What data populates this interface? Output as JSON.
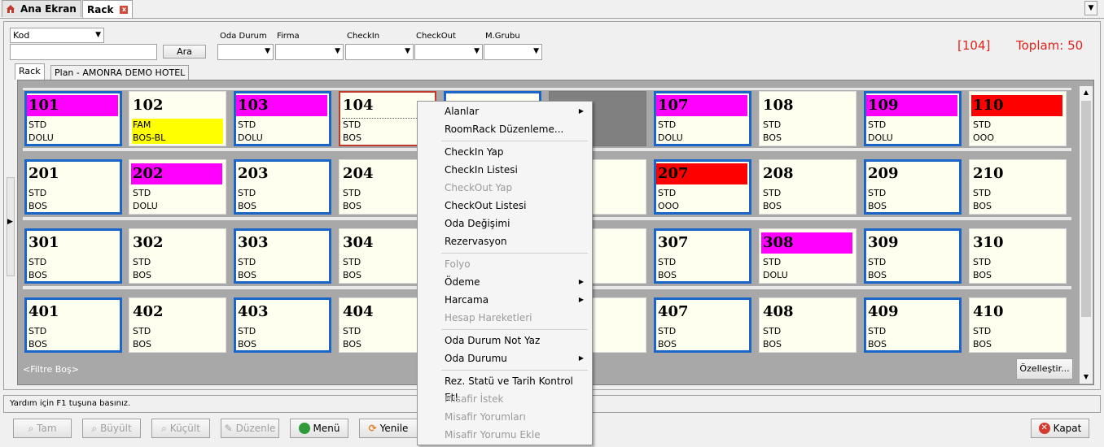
{
  "tabs": {
    "home_label": "Ana Ekran",
    "rack_label": "Rack",
    "close_glyph": "x"
  },
  "filters": {
    "field_select": "Kod",
    "search_value": "",
    "search_button": "Ara",
    "oda_durum_label": "Oda Durum",
    "firma_label": "Firma",
    "checkin_label": "CheckIn",
    "checkout_label": "CheckOut",
    "mgrubu_label": "M.Grubu"
  },
  "info": {
    "selected_room": "[104]",
    "total": "Toplam: 50"
  },
  "inner_tabs": {
    "rack": "Rack",
    "plan": "Plan - AMONRA DEMO HOTEL"
  },
  "rooms": [
    [
      {
        "num": "101",
        "type": "STD",
        "status": "DOLU",
        "num_bg": "#ff00ff",
        "type_bg": "",
        "stat_bg": "",
        "style": "sel"
      },
      {
        "num": "102",
        "type": "FAM",
        "status": "BOS-BL",
        "num_bg": "",
        "type_bg": "#ffff00",
        "stat_bg": "#ffff00",
        "style": "plain"
      },
      {
        "num": "103",
        "type": "STD",
        "status": "DOLU",
        "num_bg": "#ff00ff",
        "type_bg": "",
        "stat_bg": "",
        "style": "sel"
      },
      {
        "num": "104",
        "type": "STD",
        "status": "BOS",
        "num_bg": "",
        "type_bg": "",
        "stat_bg": "",
        "style": "focus"
      },
      {
        "num": "",
        "type": "",
        "status": "",
        "num_bg": "",
        "type_bg": "",
        "stat_bg": "",
        "style": "sel"
      },
      {
        "num": "",
        "type": "",
        "status": "",
        "num_bg": "",
        "type_bg": "",
        "stat_bg": "",
        "style": "gray"
      },
      {
        "num": "107",
        "type": "STD",
        "status": "DOLU",
        "num_bg": "#ff00ff",
        "type_bg": "",
        "stat_bg": "",
        "style": "sel"
      },
      {
        "num": "108",
        "type": "STD",
        "status": "BOS",
        "num_bg": "",
        "type_bg": "",
        "stat_bg": "",
        "style": "plain"
      },
      {
        "num": "109",
        "type": "STD",
        "status": "DOLU",
        "num_bg": "#ff00ff",
        "type_bg": "",
        "stat_bg": "",
        "style": "sel"
      },
      {
        "num": "110",
        "type": "STD",
        "status": "OOO",
        "num_bg": "#ff0000",
        "type_bg": "",
        "stat_bg": "",
        "style": "plain"
      }
    ],
    [
      {
        "num": "201",
        "type": "STD",
        "status": "BOS",
        "num_bg": "",
        "type_bg": "",
        "stat_bg": "",
        "style": "sel"
      },
      {
        "num": "202",
        "type": "STD",
        "status": "DOLU",
        "num_bg": "#ff00ff",
        "type_bg": "",
        "stat_bg": "",
        "style": "plain"
      },
      {
        "num": "203",
        "type": "STD",
        "status": "BOS",
        "num_bg": "",
        "type_bg": "",
        "stat_bg": "",
        "style": "sel"
      },
      {
        "num": "204",
        "type": "STD",
        "status": "BOS",
        "num_bg": "",
        "type_bg": "",
        "stat_bg": "",
        "style": "plain"
      },
      {
        "num": "",
        "type": "",
        "status": "",
        "num_bg": "",
        "type_bg": "",
        "stat_bg": "",
        "style": "sel"
      },
      {
        "num": "",
        "type": "",
        "status": "",
        "num_bg": "",
        "type_bg": "",
        "stat_bg": "",
        "style": "plain"
      },
      {
        "num": "207",
        "type": "STD",
        "status": "OOO",
        "num_bg": "#ff0000",
        "type_bg": "",
        "stat_bg": "",
        "style": "sel"
      },
      {
        "num": "208",
        "type": "STD",
        "status": "BOS",
        "num_bg": "",
        "type_bg": "",
        "stat_bg": "",
        "style": "plain"
      },
      {
        "num": "209",
        "type": "STD",
        "status": "BOS",
        "num_bg": "",
        "type_bg": "",
        "stat_bg": "",
        "style": "sel"
      },
      {
        "num": "210",
        "type": "STD",
        "status": "BOS",
        "num_bg": "",
        "type_bg": "",
        "stat_bg": "",
        "style": "plain"
      }
    ],
    [
      {
        "num": "301",
        "type": "STD",
        "status": "BOS",
        "num_bg": "",
        "type_bg": "",
        "stat_bg": "",
        "style": "sel"
      },
      {
        "num": "302",
        "type": "STD",
        "status": "BOS",
        "num_bg": "",
        "type_bg": "",
        "stat_bg": "",
        "style": "plain"
      },
      {
        "num": "303",
        "type": "STD",
        "status": "BOS",
        "num_bg": "",
        "type_bg": "",
        "stat_bg": "",
        "style": "sel"
      },
      {
        "num": "304",
        "type": "STD",
        "status": "BOS",
        "num_bg": "",
        "type_bg": "",
        "stat_bg": "",
        "style": "plain"
      },
      {
        "num": "",
        "type": "",
        "status": "",
        "num_bg": "",
        "type_bg": "",
        "stat_bg": "",
        "style": "sel"
      },
      {
        "num": "",
        "type": "",
        "status": "",
        "num_bg": "",
        "type_bg": "",
        "stat_bg": "",
        "style": "plain"
      },
      {
        "num": "307",
        "type": "STD",
        "status": "BOS",
        "num_bg": "",
        "type_bg": "",
        "stat_bg": "",
        "style": "sel"
      },
      {
        "num": "308",
        "type": "STD",
        "status": "DOLU",
        "num_bg": "#ff00ff",
        "type_bg": "",
        "stat_bg": "",
        "style": "plain"
      },
      {
        "num": "309",
        "type": "STD",
        "status": "BOS",
        "num_bg": "",
        "type_bg": "",
        "stat_bg": "",
        "style": "sel"
      },
      {
        "num": "310",
        "type": "STD",
        "status": "BOS",
        "num_bg": "",
        "type_bg": "",
        "stat_bg": "",
        "style": "plain"
      }
    ],
    [
      {
        "num": "401",
        "type": "STD",
        "status": "BOS",
        "num_bg": "",
        "type_bg": "",
        "stat_bg": "",
        "style": "sel"
      },
      {
        "num": "402",
        "type": "STD",
        "status": "BOS",
        "num_bg": "",
        "type_bg": "",
        "stat_bg": "",
        "style": "plain"
      },
      {
        "num": "403",
        "type": "STD",
        "status": "BOS",
        "num_bg": "",
        "type_bg": "",
        "stat_bg": "",
        "style": "sel"
      },
      {
        "num": "404",
        "type": "STD",
        "status": "BOS",
        "num_bg": "",
        "type_bg": "",
        "stat_bg": "",
        "style": "plain"
      },
      {
        "num": "",
        "type": "",
        "status": "",
        "num_bg": "",
        "type_bg": "",
        "stat_bg": "",
        "style": "sel"
      },
      {
        "num": "",
        "type": "",
        "status": "",
        "num_bg": "",
        "type_bg": "",
        "stat_bg": "",
        "style": "plain"
      },
      {
        "num": "407",
        "type": "STD",
        "status": "BOS",
        "num_bg": "",
        "type_bg": "",
        "stat_bg": "",
        "style": "sel"
      },
      {
        "num": "408",
        "type": "STD",
        "status": "BOS",
        "num_bg": "",
        "type_bg": "",
        "stat_bg": "",
        "style": "plain"
      },
      {
        "num": "409",
        "type": "STD",
        "status": "BOS",
        "num_bg": "",
        "type_bg": "",
        "stat_bg": "",
        "style": "sel"
      },
      {
        "num": "410",
        "type": "STD",
        "status": "BOS",
        "num_bg": "",
        "type_bg": "",
        "stat_bg": "",
        "style": "plain"
      }
    ]
  ],
  "rack_footer": {
    "filter_text": "<Filtre Boş>",
    "customize_button": "Özelleştir..."
  },
  "status_text": "Yardım için F1 tuşuna basınız.",
  "bottom_buttons": {
    "tam": "Tam",
    "buyult": "Büyült",
    "kucult": "Küçült",
    "duzenle": "Düzenle",
    "menu": "Menü",
    "yenile": "Yenile",
    "kapat": "Kapat"
  },
  "context_menu": {
    "items": [
      {
        "label": "Alanlar",
        "disabled": false,
        "submenu": true
      },
      {
        "label": "RoomRack Düzenleme...",
        "disabled": false,
        "submenu": false
      },
      {
        "label": "CheckIn Yap",
        "disabled": false,
        "submenu": false
      },
      {
        "label": "CheckIn Listesi",
        "disabled": false,
        "submenu": false
      },
      {
        "label": "CheckOut Yap",
        "disabled": true,
        "submenu": false
      },
      {
        "label": "CheckOut Listesi",
        "disabled": false,
        "submenu": false
      },
      {
        "label": "Oda Değişimi",
        "disabled": false,
        "submenu": false
      },
      {
        "label": "Rezervasyon",
        "disabled": false,
        "submenu": false
      },
      {
        "label": "Folyo",
        "disabled": true,
        "submenu": false
      },
      {
        "label": "Ödeme",
        "disabled": false,
        "submenu": true
      },
      {
        "label": "Harcama",
        "disabled": false,
        "submenu": true
      },
      {
        "label": "Hesap Hareketleri",
        "disabled": true,
        "submenu": false
      },
      {
        "label": "Oda Durum Not Yaz",
        "disabled": false,
        "submenu": false
      },
      {
        "label": "Oda Durumu",
        "disabled": false,
        "submenu": true
      },
      {
        "label": "Rez. Statü ve Tarih Kontrol Et!",
        "disabled": false,
        "submenu": false
      },
      {
        "label": "Misafir İstek",
        "disabled": true,
        "submenu": false
      },
      {
        "label": "Misafir Yorumları",
        "disabled": true,
        "submenu": false
      },
      {
        "label": "Misafir Yorumu Ekle",
        "disabled": true,
        "submenu": false
      }
    ]
  },
  "colors": {
    "accent_red": "#e0241c",
    "selected_border": "#1a66c8",
    "dolu": "#ff00ff",
    "ooo": "#ff0000",
    "blocked": "#ffff00"
  }
}
